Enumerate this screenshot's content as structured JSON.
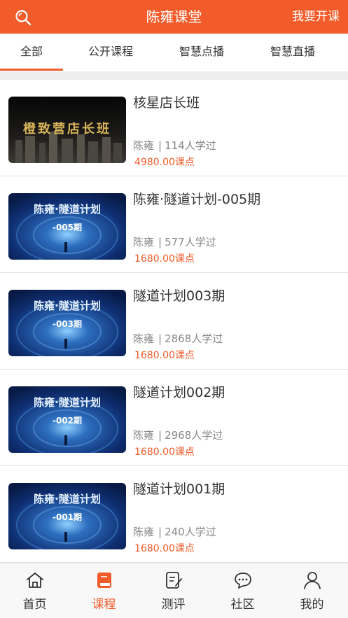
{
  "header": {
    "title": "陈雍课堂",
    "action_label": "我要开课",
    "search_icon": "search-icon"
  },
  "tabs": [
    {
      "label": "全部",
      "active": true
    },
    {
      "label": "公开课程",
      "active": false
    },
    {
      "label": "智慧点播",
      "active": false
    },
    {
      "label": "智慧直播",
      "active": false
    }
  ],
  "courses": [
    {
      "title": "核星店长班",
      "teacher": "陈雍",
      "learners": "114人学过",
      "price": "4980.00课点",
      "thumb": {
        "style": "dark",
        "caption": "橙致营店长班"
      }
    },
    {
      "title": "陈雍·隧道计划-005期",
      "teacher": "陈雍",
      "learners": "577人学过",
      "price": "1680.00课点",
      "thumb": {
        "style": "blue",
        "caption": "陈雍·隧道计划",
        "sub": "-005期"
      }
    },
    {
      "title": "隧道计划003期",
      "teacher": "陈雍",
      "learners": "2868人学过",
      "price": "1680.00课点",
      "thumb": {
        "style": "blue",
        "caption": "陈雍·隧道计划",
        "sub": "-003期"
      }
    },
    {
      "title": "隧道计划002期",
      "teacher": "陈雍",
      "learners": "2968人学过",
      "price": "1680.00课点",
      "thumb": {
        "style": "blue",
        "caption": "陈雍·隧道计划",
        "sub": "-002期"
      }
    },
    {
      "title": "隧道计划001期",
      "teacher": "陈雍",
      "learners": "240人学过",
      "price": "1680.00课点",
      "thumb": {
        "style": "blue",
        "caption": "陈雍·隧道计划",
        "sub": "-001期"
      }
    }
  ],
  "meta_separator": "|",
  "bottom_nav": [
    {
      "label": "首页",
      "icon": "home-icon",
      "active": false
    },
    {
      "label": "课程",
      "icon": "book-icon",
      "active": true
    },
    {
      "label": "测评",
      "icon": "edit-icon",
      "active": false
    },
    {
      "label": "社区",
      "icon": "chat-icon",
      "active": false
    },
    {
      "label": "我的",
      "icon": "user-icon",
      "active": false
    }
  ],
  "colors": {
    "accent": "#f25c2b",
    "text": "#333333",
    "muted": "#888888",
    "divider": "#ededed"
  }
}
